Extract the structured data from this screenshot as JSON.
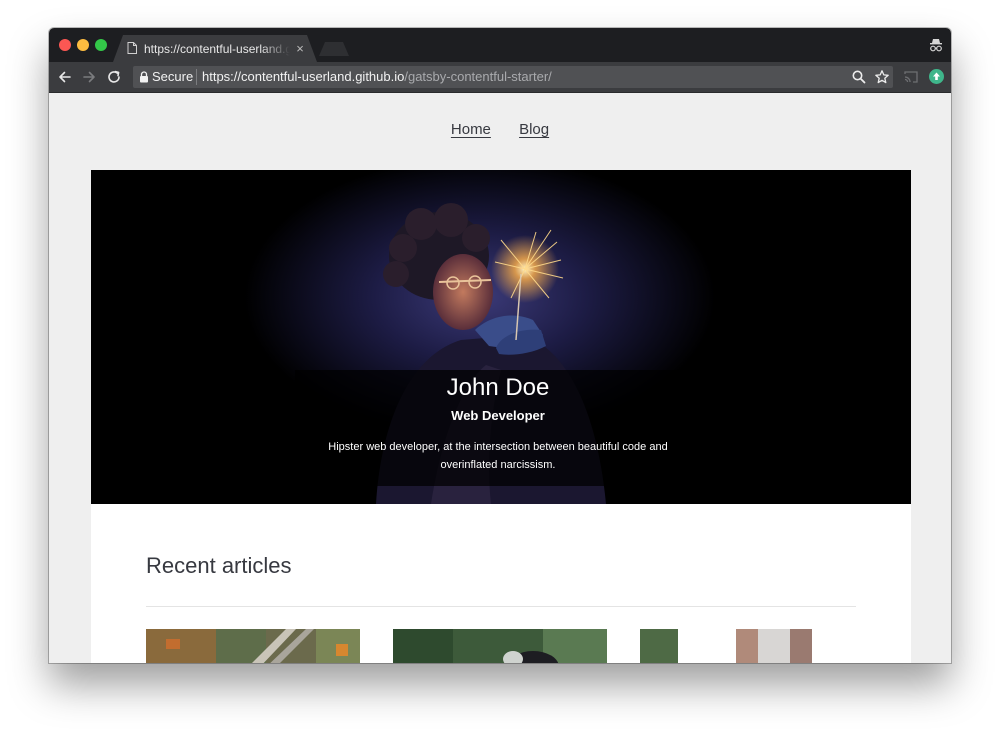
{
  "browser": {
    "tab": {
      "title": "https://contentful-userland.github.io/gatsby-contentful-starter/",
      "close_glyph": "×"
    },
    "omnibox": {
      "secure_label": "Secure",
      "url_host": "https://contentful-userland.github.io",
      "url_path": "/gatsby-contentful-starter/"
    },
    "icons": {
      "back": "arrow-left-icon",
      "forward": "arrow-right-icon",
      "reload": "reload-icon",
      "lock": "lock-icon",
      "zoom": "magnifier-icon",
      "bookmark": "star-icon",
      "cast": "cast-icon",
      "incognito": "incognito-icon"
    },
    "traffic_lights": [
      "#fc5753",
      "#fdbc40",
      "#33c748"
    ]
  },
  "page": {
    "nav": [
      {
        "label": "Home"
      },
      {
        "label": "Blog"
      }
    ],
    "hero": {
      "name": "John Doe",
      "role": "Web Developer",
      "bio": "Hipster web developer, at the intersection between beautiful code and overinflated narcissism."
    },
    "recent": {
      "title": "Recent articles"
    }
  }
}
